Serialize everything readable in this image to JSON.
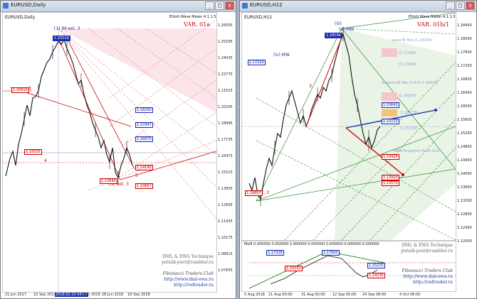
{
  "left": {
    "title": "EURUSD,Daily",
    "symbol": "EURUSD,Daily",
    "indicator": "Elliott Wave Maker 4.1.1.5",
    "variant": "VAR. 01a",
    "waves": {
      "w1": "[1] IM ext. 3",
      "w2": "3",
      "w3": "4",
      "w4": "5",
      "w5": "(iv) ext. 3"
    },
    "levels": {
      "top_fill": "1.25519",
      "l1": "1.20910",
      "l2": "1.15535",
      "b1": "1.18200",
      "b2": "1.17947",
      "b3": "1.16875",
      "r1": "1.14140",
      "r2": "1.12640",
      "r3": "1.10857"
    },
    "price_axis": [
      "1.26555",
      "1.25295",
      "1.24035",
      "1.22775",
      "1.21515",
      "1.20255",
      "1.18995",
      "1.17735",
      "1.16475",
      "1.15215",
      "1.13955",
      "1.12695",
      "1.11435",
      "1.10175",
      "1.08915",
      "1.07655"
    ],
    "dates": [
      "21 Jun 2017",
      "22 Sep 2017",
      "2018.02.15 04:00",
      "Mar 2018",
      "28 Jun 2018",
      "18 Sep 2018"
    ],
    "footer": {
      "l1": "DML & EWA Technique",
      "l2": "putnik-post@rambler.ru",
      "l3": "Fibonacci   Traders   Club",
      "l4": "http://www.dml-ewa.ru",
      "l5": "http://redtrader.ru"
    }
  },
  "right": {
    "title": "EURUSD,H12",
    "symbol": "EURUSD,H12",
    "indicator": "Elliott Wave Maker 4.1.1.5",
    "variant": "VAR. 01b/1",
    "waves": {
      "a": "(iii)",
      "b": "(iv) MW",
      "c": "(v) MW",
      "d": "3",
      "e": "A IM ext. 3"
    },
    "levels": {
      "top": "1.18144",
      "l1": "1.17220",
      "b1": "1.15642",
      "b2": "1.15215",
      "l3": "1.14424",
      "r1": "1.13920",
      "r2": "1.13573",
      "bl": "1.16807"
    },
    "pale_labels": [
      "wave-W fibo (1.18144)",
      "(1.17466)",
      "(1.17240)",
      "tk wave-W fibo (0.618 1.16816)",
      "(1.16200)",
      "(1.15778)",
      "(1.15150)",
      "MMN-Keypoints-Pivot-Grid"
    ],
    "price_axis": [
      "1.18400",
      "1.18000",
      "1.17600",
      "1.17200",
      "1.16800",
      "1.16400",
      "1.16000",
      "1.15600",
      "1.15200",
      "1.14800",
      "1.14400",
      "1.14000",
      "1.13600",
      "1.13200",
      "1.12800",
      "1.12400",
      "1.12000"
    ],
    "dates": [
      "5 Aug 2018",
      "21 Aug 00:00",
      "31 Aug 00:00",
      "12 Sep 00:00",
      "24 Sep 08:00",
      "4 Oct 08:00"
    ],
    "sub": {
      "label": "MLM 0.000000 0.000000 0.000000 0.000000 0.000000 0.000000 0.000000",
      "b1": "1.17328",
      "b2": "1.17903",
      "b3": "1.15215",
      "r1": "1.16352",
      "r2": "1.14235",
      "footer1": "DML & EWA Technique",
      "footer2": "putnik-post@rambler.ru"
    },
    "footer": {
      "l3": "Fibonacci   Traders   Club",
      "l4": "http://www.dml-ewa.ru",
      "l5": "http://redtrader.ru"
    }
  },
  "ui": {
    "minimize": "_",
    "maximize": "□",
    "close": "x"
  },
  "colors": {
    "blue": "#1b2fb0",
    "red": "#c00000",
    "green": "#2f8f2f",
    "pink": "#f5c6cb"
  }
}
